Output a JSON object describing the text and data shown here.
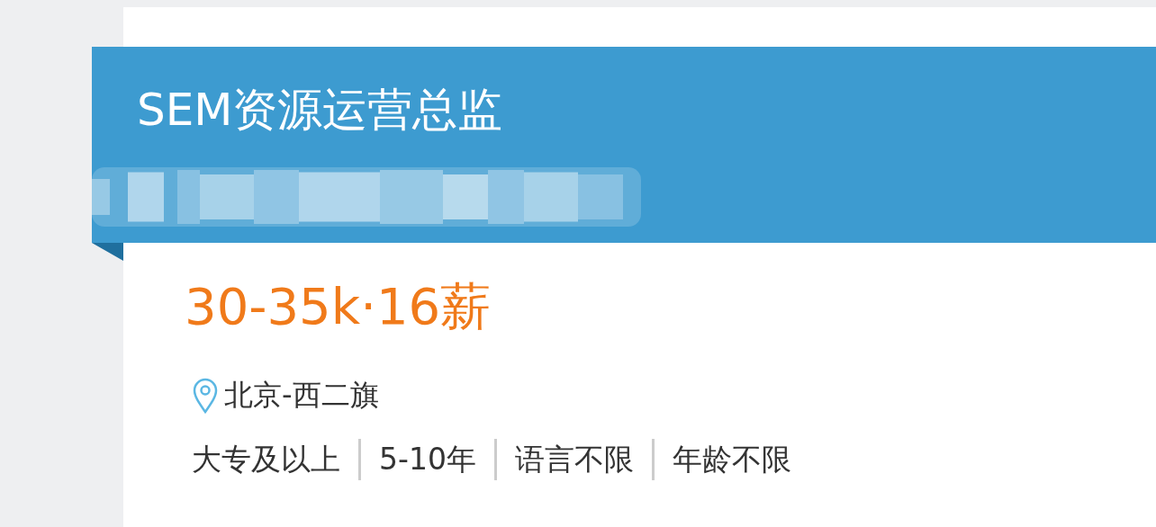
{
  "job": {
    "title": "SEM资源运营总监",
    "salary": "30-35k·16薪",
    "location": "北京-西二旗",
    "requirements": [
      "大专及以上",
      "5-10年",
      "语言不限",
      "年龄不限"
    ]
  }
}
